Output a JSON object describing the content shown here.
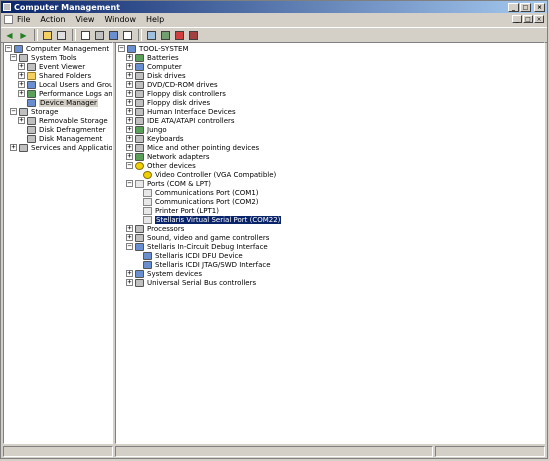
{
  "window": {
    "title": "Computer Management"
  },
  "menu": [
    "File",
    "Action",
    "View",
    "Window",
    "Help"
  ],
  "toolbar": [
    "back-icon",
    "forward-icon",
    "up-folder-icon",
    "show-hide-tree-icon",
    "export-icon",
    "print-icon",
    "help-icon",
    "properties-icon",
    "scan-hardware-icon",
    "update-driver-icon",
    "uninstall-icon",
    "disable-icon"
  ],
  "left_tree": {
    "root": "Computer Management (Local)",
    "system_tools": "System Tools",
    "event_viewer": "Event Viewer",
    "shared_folders": "Shared Folders",
    "local_users": "Local Users and Groups",
    "perf_logs": "Performance Logs and Alerts",
    "device_manager": "Device Manager",
    "storage": "Storage",
    "removable_storage": "Removable Storage",
    "disk_defrag": "Disk Defragmenter",
    "disk_mgmt": "Disk Management",
    "services": "Services and Applications"
  },
  "right_tree": {
    "root": "TOOL-SYSTEM",
    "batteries": "Batteries",
    "computer": "Computer",
    "disk_drives": "Disk drives",
    "dvd": "DVD/CD-ROM drives",
    "floppy_ctrl": "Floppy disk controllers",
    "floppy_drives": "Floppy disk drives",
    "hid": "Human Interface Devices",
    "ide": "IDE ATA/ATAPI controllers",
    "jungo": "Jungo",
    "keyboards": "Keyboards",
    "mice": "Mice and other pointing devices",
    "network": "Network adapters",
    "other": "Other devices",
    "video": "Video Controller (VGA Compatible)",
    "ports": "Ports (COM & LPT)",
    "com1": "Communications Port (COM1)",
    "com2": "Communications Port (COM2)",
    "lpt1": "Printer Port (LPT1)",
    "stellaris_vsp": "Stellaris Virtual Serial Port (COM22)",
    "processors": "Processors",
    "sound": "Sound, video and game controllers",
    "stellaris_icdi": "Stellaris In-Circuit Debug Interface",
    "dfu": "Stellaris ICDI DFU Device",
    "jtag": "Stellaris ICDI JTAG/SWD Interface",
    "system_devices": "System devices",
    "usb": "Universal Serial Bus controllers"
  }
}
